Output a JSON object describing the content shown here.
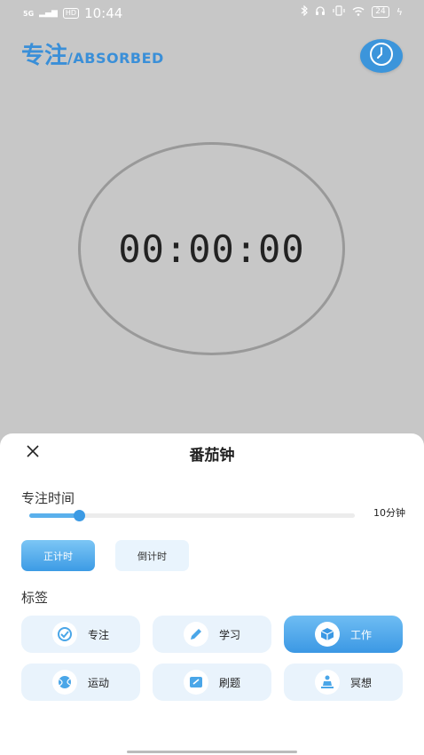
{
  "status_bar": {
    "signal": "5G",
    "hd": "HD",
    "time": "10:44",
    "icons": [
      "bluetooth-icon",
      "headphones-icon",
      "vibrate-icon",
      "wifi-icon"
    ],
    "battery": "24"
  },
  "header": {
    "title_cn": "专注",
    "title_en": "/ABSORBED",
    "clock_icon": "clock-icon"
  },
  "timer": {
    "display": "00:00:00"
  },
  "sheet": {
    "title": "番茄钟",
    "close_icon": "close-icon",
    "focus_time_label": "专注时间",
    "slider": {
      "value": 10,
      "min": 0,
      "max": 120,
      "value_label": "10分钟"
    },
    "modes": [
      {
        "label": "正计时",
        "active": true
      },
      {
        "label": "倒计时",
        "active": false
      }
    ],
    "tags_label": "标签",
    "tags": [
      {
        "label": "专注",
        "icon": "check-circle-icon",
        "active": false
      },
      {
        "label": "学习",
        "icon": "pen-icon",
        "active": false
      },
      {
        "label": "工作",
        "icon": "box-icon",
        "active": true
      },
      {
        "label": "运动",
        "icon": "ball-icon",
        "active": false
      },
      {
        "label": "刷题",
        "icon": "edit-icon",
        "active": false
      },
      {
        "label": "冥想",
        "icon": "meditation-icon",
        "active": false
      }
    ]
  },
  "colors": {
    "accent": "#3a8fd8",
    "active_button": "#3c9be5",
    "inactive_button": "#e9f4fd",
    "overlay_background": "#c7c7c7"
  }
}
